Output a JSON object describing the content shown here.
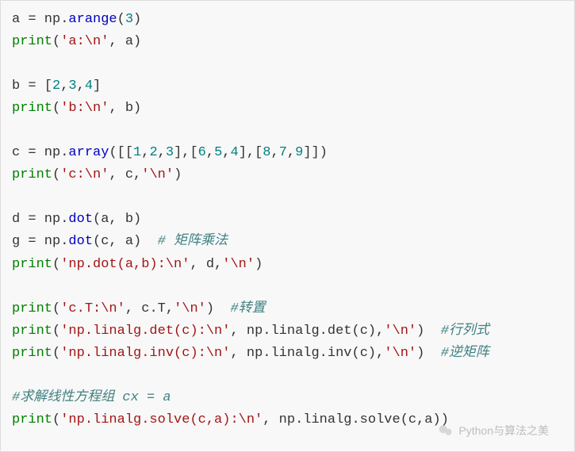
{
  "code": {
    "l1a": "a = np.",
    "l1b": "arange",
    "l1c": "(",
    "l1d": "3",
    "l1e": ")",
    "l2a": "print",
    "l2b": "(",
    "l2c": "'a:\\n'",
    "l2d": ", a)",
    "l3a": "b = [",
    "l3b": "2",
    "l3c": ",",
    "l3d": "3",
    "l3e": ",",
    "l3f": "4",
    "l3g": "]",
    "l4a": "print",
    "l4b": "(",
    "l4c": "'b:\\n'",
    "l4d": ", b)",
    "l5a": "c = np.",
    "l5b": "array",
    "l5c": "([[",
    "l5d": "1",
    "l5e": ",",
    "l5f": "2",
    "l5g": ",",
    "l5h": "3",
    "l5i": "],[",
    "l5j": "6",
    "l5k": ",",
    "l5l": "5",
    "l5m": ",",
    "l5n": "4",
    "l5o": "],[",
    "l5p": "8",
    "l5q": ",",
    "l5r": "7",
    "l5s": ",",
    "l5t": "9",
    "l5u": "]])",
    "l6a": "print",
    "l6b": "(",
    "l6c": "'c:\\n'",
    "l6d": ", c,",
    "l6e": "'\\n'",
    "l6f": ")",
    "l7a": "d = np.",
    "l7b": "dot",
    "l7c": "(a, b)",
    "l8a": "g = np.",
    "l8b": "dot",
    "l8c": "(c, a)  ",
    "l8d": "# 矩阵乘法",
    "l9a": "print",
    "l9b": "(",
    "l9c": "'np.dot(a,b):\\n'",
    "l9d": ", d,",
    "l9e": "'\\n'",
    "l9f": ")",
    "l10a": "print",
    "l10b": "(",
    "l10c": "'c.T:\\n'",
    "l10d": ", c.T,",
    "l10e": "'\\n'",
    "l10f": ")  ",
    "l10g": "#转置",
    "l11a": "print",
    "l11b": "(",
    "l11c": "'np.linalg.det(c):\\n'",
    "l11d": ", np.linalg.det(c),",
    "l11e": "'\\n'",
    "l11f": ")  ",
    "l11g": "#行列式",
    "l12a": "print",
    "l12b": "(",
    "l12c": "'np.linalg.inv(c):\\n'",
    "l12d": ", np.linalg.inv(c),",
    "l12e": "'\\n'",
    "l12f": ")  ",
    "l12g": "#逆矩阵",
    "l13a": "#求解线性方程组 cx = a",
    "l14a": "print",
    "l14b": "(",
    "l14c": "'np.linalg.solve(c,a):\\n'",
    "l14d": ", np.linalg.solve(c,a))"
  },
  "watermark": {
    "text": "Python与算法之美"
  }
}
